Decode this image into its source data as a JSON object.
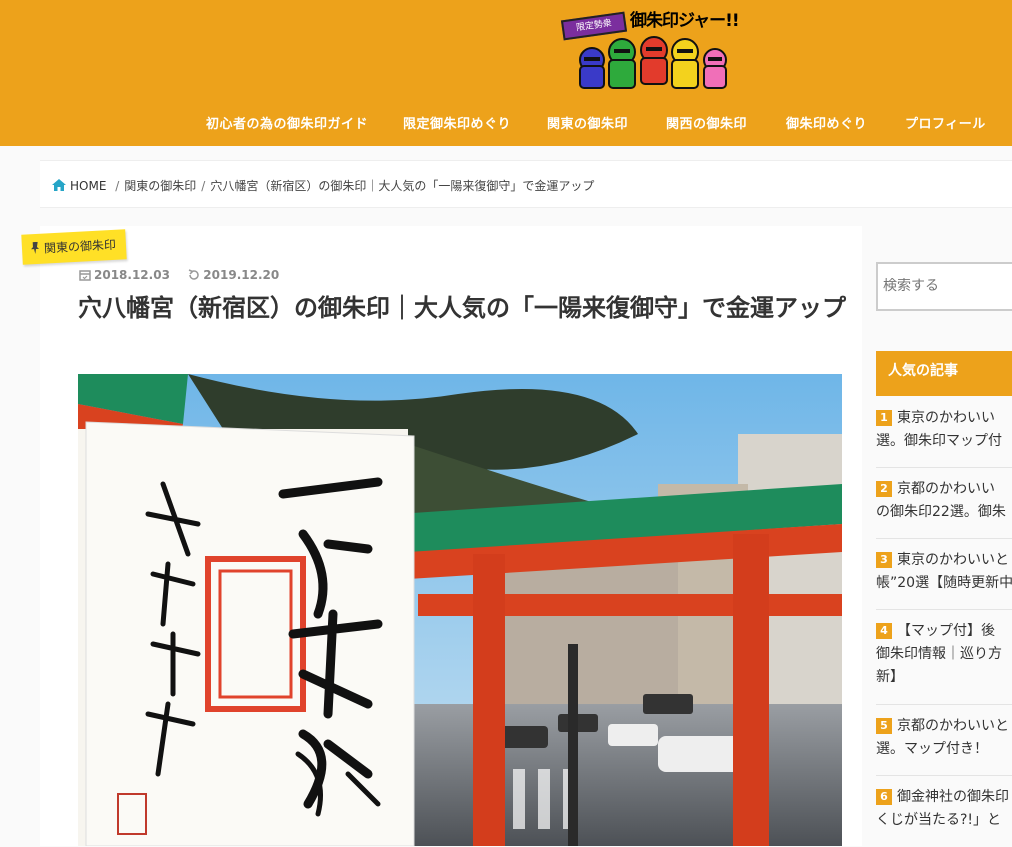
{
  "site": {
    "logo_tag": "限定勢衆",
    "logo_text": "御朱印ジャー!!"
  },
  "nav": {
    "items": [
      "初心者の為の御朱印ガイド",
      "限定御朱印めぐり",
      "関東の御朱印",
      "関西の御朱印",
      "御朱印めぐり",
      "プロフィール"
    ]
  },
  "breadcrumb": {
    "home": "HOME",
    "category": "関東の御朱印",
    "current": "穴八幡宮（新宿区）の御朱印｜大人気の「一陽来復御守」で金運アップ"
  },
  "article": {
    "category_badge": "関東の御朱印",
    "published": "2018.12.03",
    "updated": "2019.12.20",
    "title": "穴八幡宮（新宿区）の御朱印｜大人気の「一陽来復御守」で金運アップ",
    "hero_alt": "穴八幡宮の御朱印と鳥居"
  },
  "sidebar": {
    "search_placeholder": "検索する",
    "popular_title": "人気の記事",
    "popular": [
      {
        "rank": "1",
        "lines": [
          "東京のかわいい",
          "選。御朱印マップ付"
        ]
      },
      {
        "rank": "2",
        "lines": [
          "京都のかわいい",
          "の御朱印22選。御朱"
        ]
      },
      {
        "rank": "3",
        "lines": [
          "東京のかわいいと",
          "帳”20選【随時更新中"
        ]
      },
      {
        "rank": "4",
        "lines": [
          "【マップ付】後",
          "御朱印情報｜巡り方",
          "新】"
        ]
      },
      {
        "rank": "5",
        "lines": [
          "京都のかわいいと",
          "選。マップ付き！"
        ]
      },
      {
        "rank": "6",
        "lines": [
          "御金神社の御朱印",
          "くじが当たる?!」と"
        ]
      }
    ]
  },
  "colors": {
    "brand": "#eda21b",
    "badge": "#ffe026"
  }
}
